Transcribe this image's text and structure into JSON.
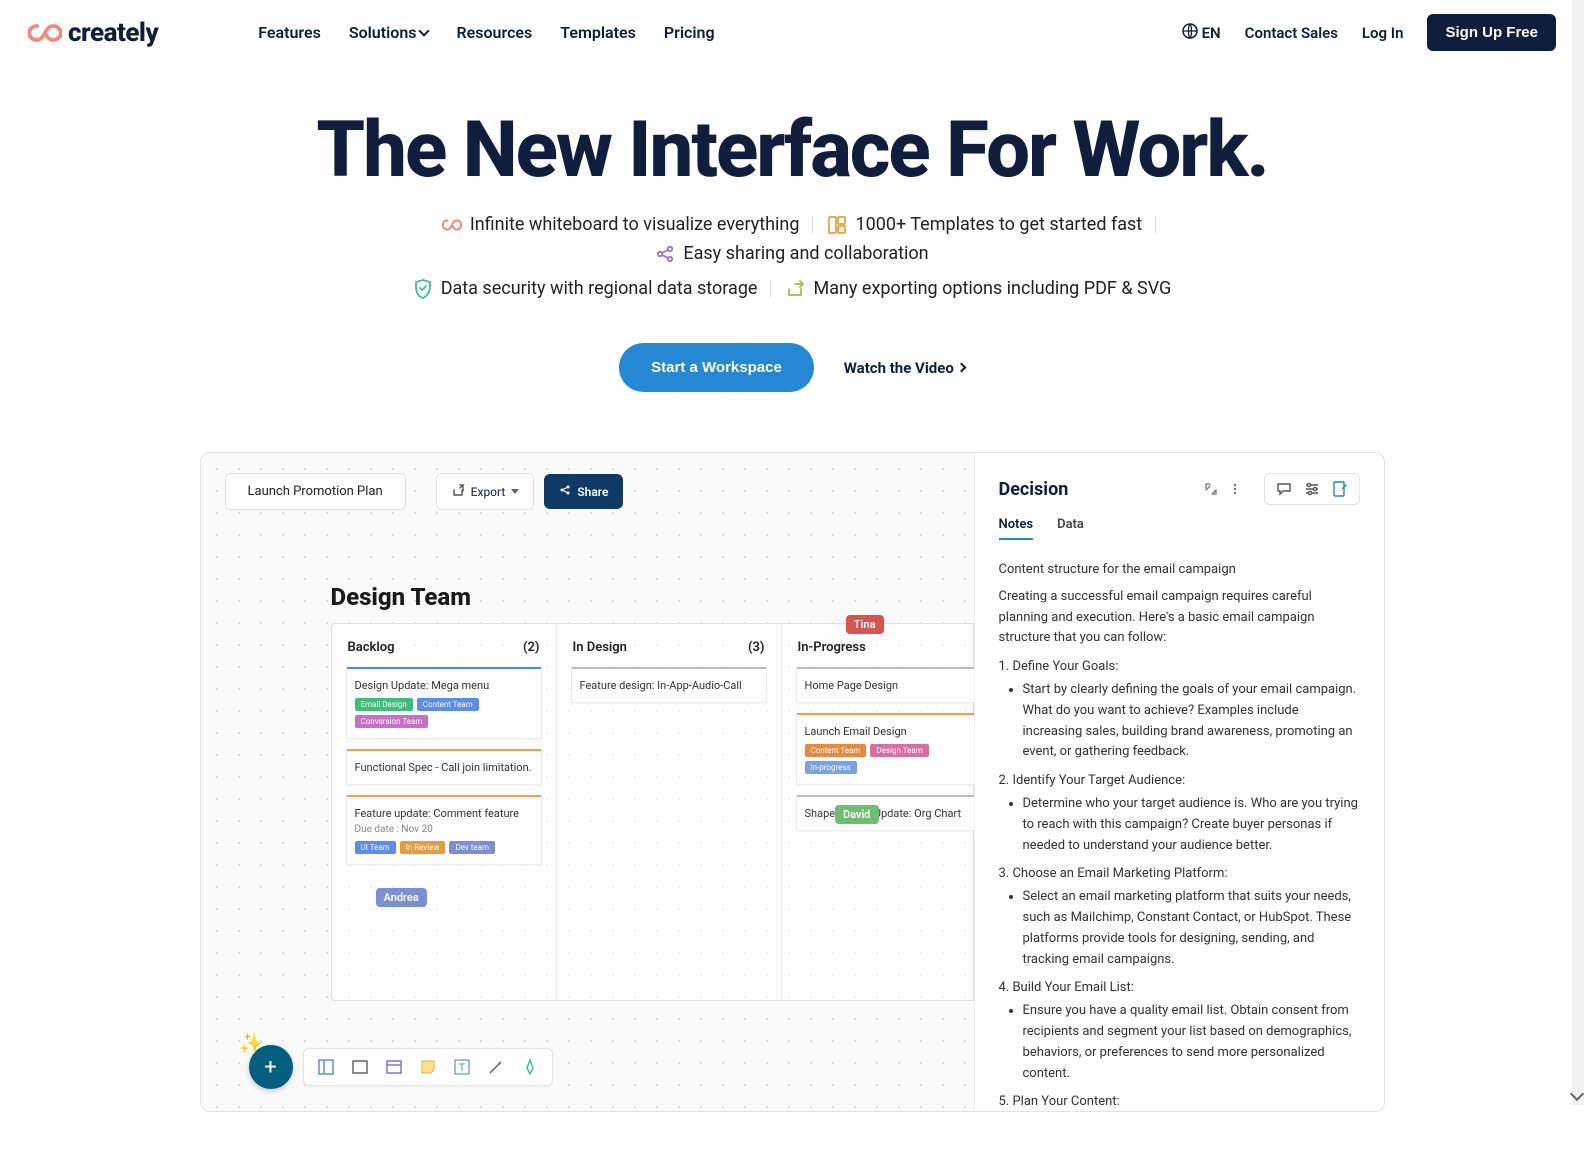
{
  "nav": {
    "brand": "creately",
    "items": [
      "Features",
      "Solutions",
      "Resources",
      "Templates",
      "Pricing"
    ],
    "lang": "EN",
    "contact": "Contact Sales",
    "login": "Log In",
    "signup": "Sign Up Free"
  },
  "hero": {
    "title": "The New Interface For Work.",
    "benefits": [
      "Infinite whiteboard to visualize everything",
      "1000+ Templates to get started fast",
      "Easy sharing and collaboration",
      "Data security with regional data storage",
      "Many exporting options including PDF & SVG"
    ],
    "cta_primary": "Start a Workspace",
    "cta_secondary": "Watch the Video"
  },
  "mock": {
    "workspace": "Launch Promotion Plan",
    "export": "Export",
    "share": "Share",
    "board_title": "Design Team",
    "columns": [
      {
        "name": "Backlog",
        "count": "(2)",
        "cards": [
          {
            "title": "Design Update: Mega menu",
            "tags": [
              {
                "label": "Email Design",
                "color": "#3dbf7a"
              },
              {
                "label": "Content Team",
                "color": "#5b8def"
              },
              {
                "label": "Conversion Team",
                "color": "#c86fc8"
              }
            ]
          },
          {
            "title": "Functional Spec - Call join limitation."
          },
          {
            "title": "Feature update: Comment feature",
            "due": "Due date : Nov 20",
            "tags": [
              {
                "label": "UI Team",
                "color": "#5b8def"
              },
              {
                "label": "In Review",
                "color": "#e69b3d"
              },
              {
                "label": "Dev team",
                "color": "#7a8fd6"
              }
            ]
          }
        ]
      },
      {
        "name": "In Design",
        "count": "(3)",
        "cards": [
          {
            "title": "Feature design: In-App-Audio-Call"
          }
        ]
      },
      {
        "name": "In-Progress",
        "count": "",
        "cards": [
          {
            "title": "Home Page Design"
          },
          {
            "title": "Launch Email Design",
            "tags": [
              {
                "label": "Content Team",
                "color": "#e68a3d"
              },
              {
                "label": "Design Team",
                "color": "#d86fa0"
              },
              {
                "label": "In-progress",
                "color": "#7aa1e6"
              }
            ]
          },
          {
            "title": "Shape Library Update: Org Chart"
          }
        ]
      }
    ],
    "cursors": {
      "tina": "Tina",
      "david": "David",
      "andrea": "Andrea"
    },
    "side": {
      "title": "Decision",
      "tabs": [
        "Notes",
        "Data"
      ],
      "lead_title": "Content structure for the email campaign",
      "lead": "Creating a successful email campaign requires careful planning and execution. Here's a basic email campaign structure that you can follow:",
      "steps": [
        {
          "h": "1. Define Your Goals:",
          "b": "Start by clearly defining the goals of your email campaign. What do you want to achieve? Examples include increasing sales, building brand awareness, promoting an event, or gathering feedback."
        },
        {
          "h": "2. Identify Your Target Audience:",
          "b": "Determine who your target audience is. Who are you trying to reach with this campaign? Create buyer personas if needed to understand your audience better."
        },
        {
          "h": "3. Choose an Email Marketing Platform:",
          "b": "Select an email marketing platform that suits your needs, such as Mailchimp, Constant Contact, or HubSpot. These platforms provide tools for designing, sending, and tracking email campaigns."
        },
        {
          "h": "4. Build Your Email List:",
          "b": "Ensure you have a quality email list. Obtain consent from recipients and segment your list based on demographics, behaviors, or preferences to send more personalized content."
        },
        {
          "h": "5. Plan Your Content:",
          "b": ""
        }
      ]
    }
  },
  "colors": {
    "primary": "#2588d5",
    "dark": "#0f1e3c"
  }
}
